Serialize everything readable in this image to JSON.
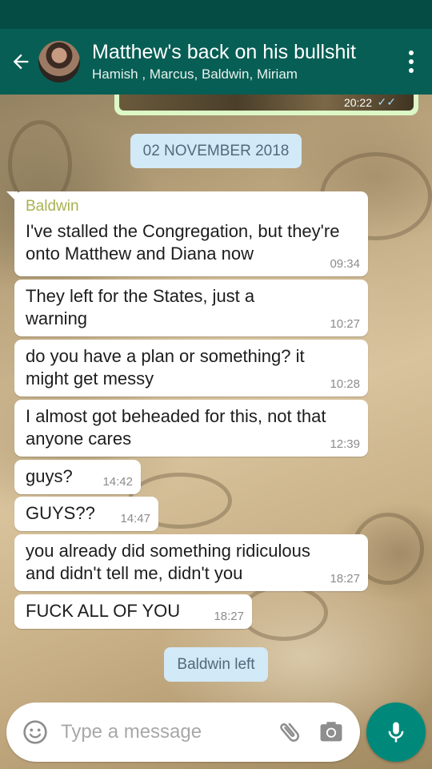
{
  "header": {
    "title": "Matthew's back on his bullshit",
    "participants": "Hamish , Marcus, Baldwin, Miriam"
  },
  "previous_message": {
    "time": "20:22"
  },
  "date_divider": "02 NOVEMBER 2018",
  "messages": [
    {
      "sender": "Baldwin",
      "lines": [
        "I've stalled the Congregation, but they're",
        "onto Matthew and Diana now"
      ],
      "time": "09:34"
    },
    {
      "lines": [
        "They left for the States, just a",
        "warning"
      ],
      "time": "10:27"
    },
    {
      "lines": [
        "do you have a plan or something? it",
        "might get messy"
      ],
      "time": "10:28"
    },
    {
      "lines": [
        "I almost got beheaded for this, not that",
        "anyone cares"
      ],
      "time": "12:39"
    },
    {
      "lines": [
        "guys?"
      ],
      "time": "14:42"
    },
    {
      "lines": [
        "GUYS??"
      ],
      "time": "14:47"
    },
    {
      "lines": [
        "you already did something ridiculous",
        "and didn't tell me, didn't you"
      ],
      "time": "18:27"
    },
    {
      "lines": [
        "FUCK ALL OF YOU"
      ],
      "time": "18:27"
    }
  ],
  "system_message": "Baldwin left",
  "composer": {
    "placeholder": "Type a message"
  },
  "icons": {
    "back": "arrow-left-icon",
    "menu": "more-vert-icon",
    "emoji": "smiley-icon",
    "attach": "paperclip-icon",
    "camera": "camera-icon",
    "mic": "microphone-icon"
  },
  "colors": {
    "header": "#075e54",
    "status_bar": "#054d44",
    "outgoing_bubble": "#dcf8c6",
    "incoming_bubble": "#ffffff",
    "sender_name": "#a8b24f",
    "system_chip": "#d2e9f7",
    "mic_button": "#00897b"
  }
}
